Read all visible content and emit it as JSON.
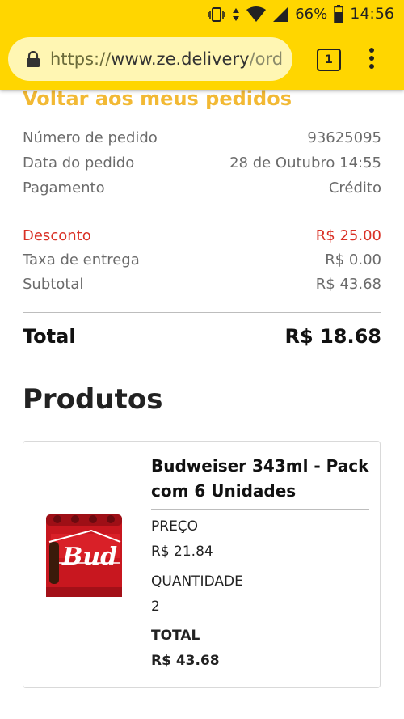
{
  "status_bar": {
    "battery": "66%",
    "time": "14:56"
  },
  "browser": {
    "url_scheme": "https://",
    "url_host": "www.ze.delivery",
    "url_path": "/orders",
    "tab_count": "1"
  },
  "back_link": "Voltar aos meus pedidos",
  "order_info": [
    {
      "label": "Número de pedido",
      "value": "93625095"
    },
    {
      "label": "Data do pedido",
      "value": "28 de Outubro 14:55"
    },
    {
      "label": "Pagamento",
      "value": "Crédito"
    }
  ],
  "pricing": {
    "discount": {
      "label": "Desconto",
      "value": "R$ 25.00"
    },
    "delivery_fee": {
      "label": "Taxa de entrega",
      "value": "R$ 0.00"
    },
    "subtotal": {
      "label": "Subtotal",
      "value": "R$ 43.68"
    },
    "total": {
      "label": "Total",
      "value": "R$ 18.68"
    }
  },
  "products_heading": "Produtos",
  "product": {
    "name": "Budweiser 343ml - Pack com 6 Unidades",
    "price_label": "PREÇO",
    "price": "R$ 21.84",
    "quantity_label": "QUANTIDADE",
    "quantity": "2",
    "total_label": "TOTAL",
    "total": "R$ 43.68",
    "image_brand_text": "Bud"
  },
  "colors": {
    "brand_yellow": "#ffd600",
    "back_link": "#f2b934",
    "discount_red": "#d93025"
  }
}
